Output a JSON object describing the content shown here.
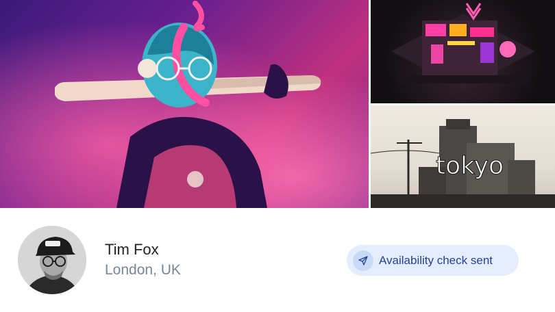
{
  "gallery": {
    "main_image": "masked figure with baseball bat artwork",
    "top_right_image": "neon city building artwork",
    "bottom_right_image": "industrial tokyo sketch artwork",
    "bottom_right_text": "tokyo"
  },
  "profile": {
    "name": "Tim Fox",
    "location": "London, UK",
    "avatar_icon": "avatar"
  },
  "status": {
    "label": "Availability check sent",
    "icon": "paper-plane-icon",
    "accent": "#27409b",
    "background": "#e3edfd"
  }
}
